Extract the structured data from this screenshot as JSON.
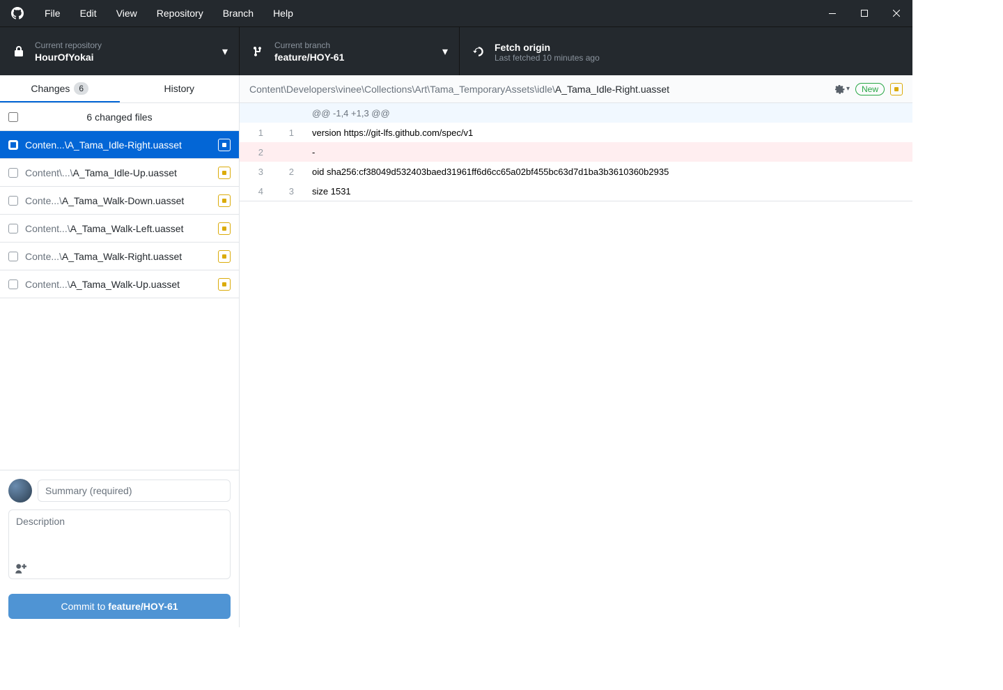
{
  "menu": {
    "file": "File",
    "edit": "Edit",
    "view": "View",
    "repository": "Repository",
    "branch": "Branch",
    "help": "Help"
  },
  "toolbar": {
    "repo_label": "Current repository",
    "repo_name": "HourOfYokai",
    "branch_label": "Current branch",
    "branch_name": "feature/HOY-61",
    "fetch_label": "Fetch origin",
    "fetch_status": "Last fetched 10 minutes ago"
  },
  "tabs": {
    "changes": "Changes",
    "changes_count": "6",
    "history": "History"
  },
  "changes_header": "6 changed files",
  "files": [
    {
      "dim": "Conten...\\",
      "name": "A_Tama_Idle-Right.uasset",
      "selected": true
    },
    {
      "dim": "Content\\...\\",
      "name": "A_Tama_Idle-Up.uasset",
      "selected": false
    },
    {
      "dim": "Conte...\\",
      "name": "A_Tama_Walk-Down.uasset",
      "selected": false
    },
    {
      "dim": "Content...\\",
      "name": "A_Tama_Walk-Left.uasset",
      "selected": false
    },
    {
      "dim": "Conte...\\",
      "name": "A_Tama_Walk-Right.uasset",
      "selected": false
    },
    {
      "dim": "Content...\\",
      "name": "A_Tama_Walk-Up.uasset",
      "selected": false
    }
  ],
  "commit": {
    "summary_placeholder": "Summary (required)",
    "description_placeholder": "Description",
    "button_prefix": "Commit to ",
    "button_branch": "feature/HOY-61"
  },
  "diff": {
    "path_dim": "Content\\Developers\\vinee\\Collections\\Art\\Tama_TemporaryAssets\\idle\\",
    "path_name": "A_Tama_Idle-Right.uasset",
    "new_badge": "New",
    "lines": [
      {
        "old": "",
        "new": "",
        "type": "hunk",
        "text": "@@ -1,4 +1,3 @@"
      },
      {
        "old": "1",
        "new": "1",
        "type": "ctx",
        "text": "version https://git-lfs.github.com/spec/v1"
      },
      {
        "old": "2",
        "new": "",
        "type": "del",
        "text": "-"
      },
      {
        "old": "3",
        "new": "2",
        "type": "ctx",
        "text": "oid sha256:cf38049d532403baed31961ff6d6cc65a02bf455bc63d7d1ba3b3610360b2935"
      },
      {
        "old": "4",
        "new": "3",
        "type": "ctx",
        "text": "size 1531"
      }
    ]
  }
}
